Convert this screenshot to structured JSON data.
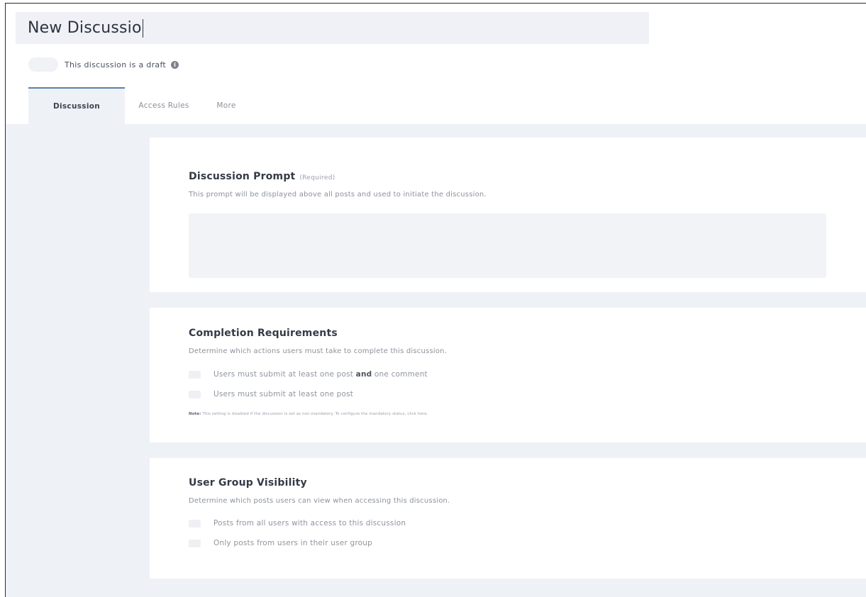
{
  "title": {
    "value": "New Discussio"
  },
  "draft": {
    "label": "This discussion is a draft",
    "info_icon": "info-icon"
  },
  "tabs": [
    {
      "label": "Discussion",
      "active": true
    },
    {
      "label": "Access Rules",
      "active": false
    },
    {
      "label": "More",
      "active": false
    }
  ],
  "prompt_section": {
    "title": "Discussion Prompt",
    "required": "(Required)",
    "description": "This prompt will be displayed above all posts and used to initiate the discussion.",
    "value": ""
  },
  "completion": {
    "title": "Completion Requirements",
    "description": "Determine which actions users must take to complete this discussion.",
    "option1_pre": "Users must submit at least one post",
    "option1_bold": "and",
    "option1_post": "one comment",
    "option2": "Users must submit at least one post",
    "note_label": "Note:",
    "note_text": "This setting is disabled if the discussion is set as non-mandatory. To configure the mandatory status, click here."
  },
  "visibility": {
    "title": "User Group Visibility",
    "description": "Determine which posts users can view when accessing this discussion.",
    "option1": "Posts from all users with access to this discussion",
    "option2": "Only posts from users in their user group"
  },
  "colors": {
    "background": "#eef1f6",
    "card": "#ffffff",
    "tab_active_border": "#5a82a8",
    "text_primary": "#343a46",
    "text_muted": "#8c929c"
  }
}
